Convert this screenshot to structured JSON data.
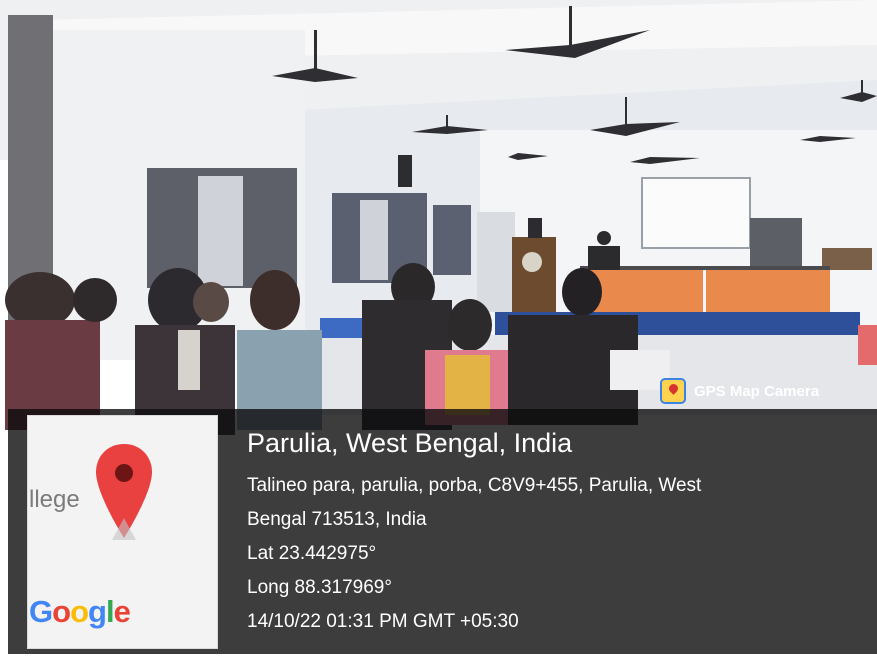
{
  "badge": {
    "label": "GPS Map Camera",
    "icon": "gps-map-camera-icon"
  },
  "map_thumbnail": {
    "place_fragment": "llege",
    "logo_text": "Google",
    "marker_icon": "map-pin-icon"
  },
  "location": {
    "title": "Parulia, West Bengal, India",
    "address_line_1": "Talineo para, parulia, porba, C8V9+455, Parulia, West",
    "address_line_2": "Bengal 713513, India",
    "latitude": "Lat 23.442975°",
    "longitude": "Long 88.317969°",
    "timestamp": "14/10/22 01:31 PM GMT +05:30"
  },
  "colors": {
    "pin": "#e94040",
    "overlay": "#0c0c0e",
    "ceiling": "#f2f3f5",
    "stage_table": "#e98a4c",
    "stage_skirt": "#2e4f9a"
  }
}
